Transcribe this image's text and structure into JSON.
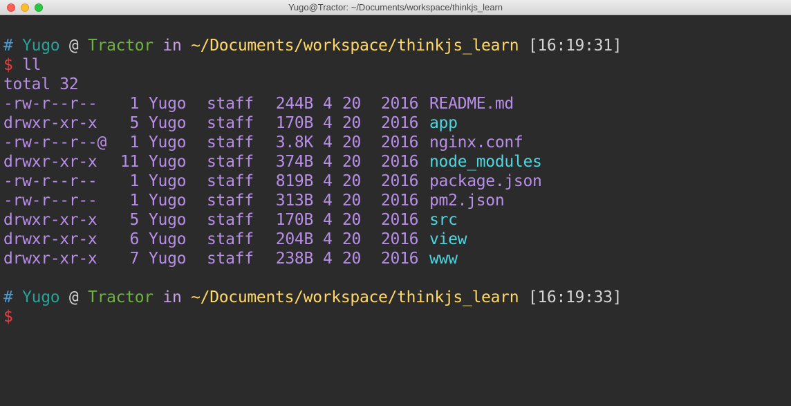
{
  "colors": {
    "background": "#2b2b2b",
    "hash": "#4a9bd4",
    "user": "#2aa198",
    "at": "#d4d4d4",
    "host": "#6db33f",
    "in": "#c9a0e8",
    "path": "#ffd866",
    "time": "#d4d4d4",
    "dollar": "#e24040",
    "text": "#b88ee8",
    "dir": "#4dd6e0"
  },
  "window": {
    "title": "Yugo@Tractor: ~/Documents/workspace/thinkjs_learn"
  },
  "prompt1": {
    "hash": "#",
    "user": "Yugo",
    "at": "@",
    "host": "Tractor",
    "in": "in",
    "path": "~/Documents/workspace/thinkjs_learn",
    "time": "[16:19:31]",
    "dollar": "$",
    "command": "ll"
  },
  "total": "total 32",
  "listing": [
    {
      "perm": "-rw-r--r--",
      "links": "1",
      "owner": "Yugo",
      "group": "staff",
      "size": "244B",
      "month": "4",
      "day": "20",
      "year": "2016",
      "name": "README.md",
      "is_dir": false
    },
    {
      "perm": "drwxr-xr-x",
      "links": "5",
      "owner": "Yugo",
      "group": "staff",
      "size": "170B",
      "month": "4",
      "day": "20",
      "year": "2016",
      "name": "app",
      "is_dir": true
    },
    {
      "perm": "-rw-r--r--@",
      "links": "1",
      "owner": "Yugo",
      "group": "staff",
      "size": "3.8K",
      "month": "4",
      "day": "20",
      "year": "2016",
      "name": "nginx.conf",
      "is_dir": false
    },
    {
      "perm": "drwxr-xr-x",
      "links": "11",
      "owner": "Yugo",
      "group": "staff",
      "size": "374B",
      "month": "4",
      "day": "20",
      "year": "2016",
      "name": "node_modules",
      "is_dir": true
    },
    {
      "perm": "-rw-r--r--",
      "links": "1",
      "owner": "Yugo",
      "group": "staff",
      "size": "819B",
      "month": "4",
      "day": "20",
      "year": "2016",
      "name": "package.json",
      "is_dir": false
    },
    {
      "perm": "-rw-r--r--",
      "links": "1",
      "owner": "Yugo",
      "group": "staff",
      "size": "313B",
      "month": "4",
      "day": "20",
      "year": "2016",
      "name": "pm2.json",
      "is_dir": false
    },
    {
      "perm": "drwxr-xr-x",
      "links": "5",
      "owner": "Yugo",
      "group": "staff",
      "size": "170B",
      "month": "4",
      "day": "20",
      "year": "2016",
      "name": "src",
      "is_dir": true
    },
    {
      "perm": "drwxr-xr-x",
      "links": "6",
      "owner": "Yugo",
      "group": "staff",
      "size": "204B",
      "month": "4",
      "day": "20",
      "year": "2016",
      "name": "view",
      "is_dir": true
    },
    {
      "perm": "drwxr-xr-x",
      "links": "7",
      "owner": "Yugo",
      "group": "staff",
      "size": "238B",
      "month": "4",
      "day": "20",
      "year": "2016",
      "name": "www",
      "is_dir": true
    }
  ],
  "prompt2": {
    "hash": "#",
    "user": "Yugo",
    "at": "@",
    "host": "Tractor",
    "in": "in",
    "path": "~/Documents/workspace/thinkjs_learn",
    "time": "[16:19:33]",
    "dollar": "$"
  }
}
